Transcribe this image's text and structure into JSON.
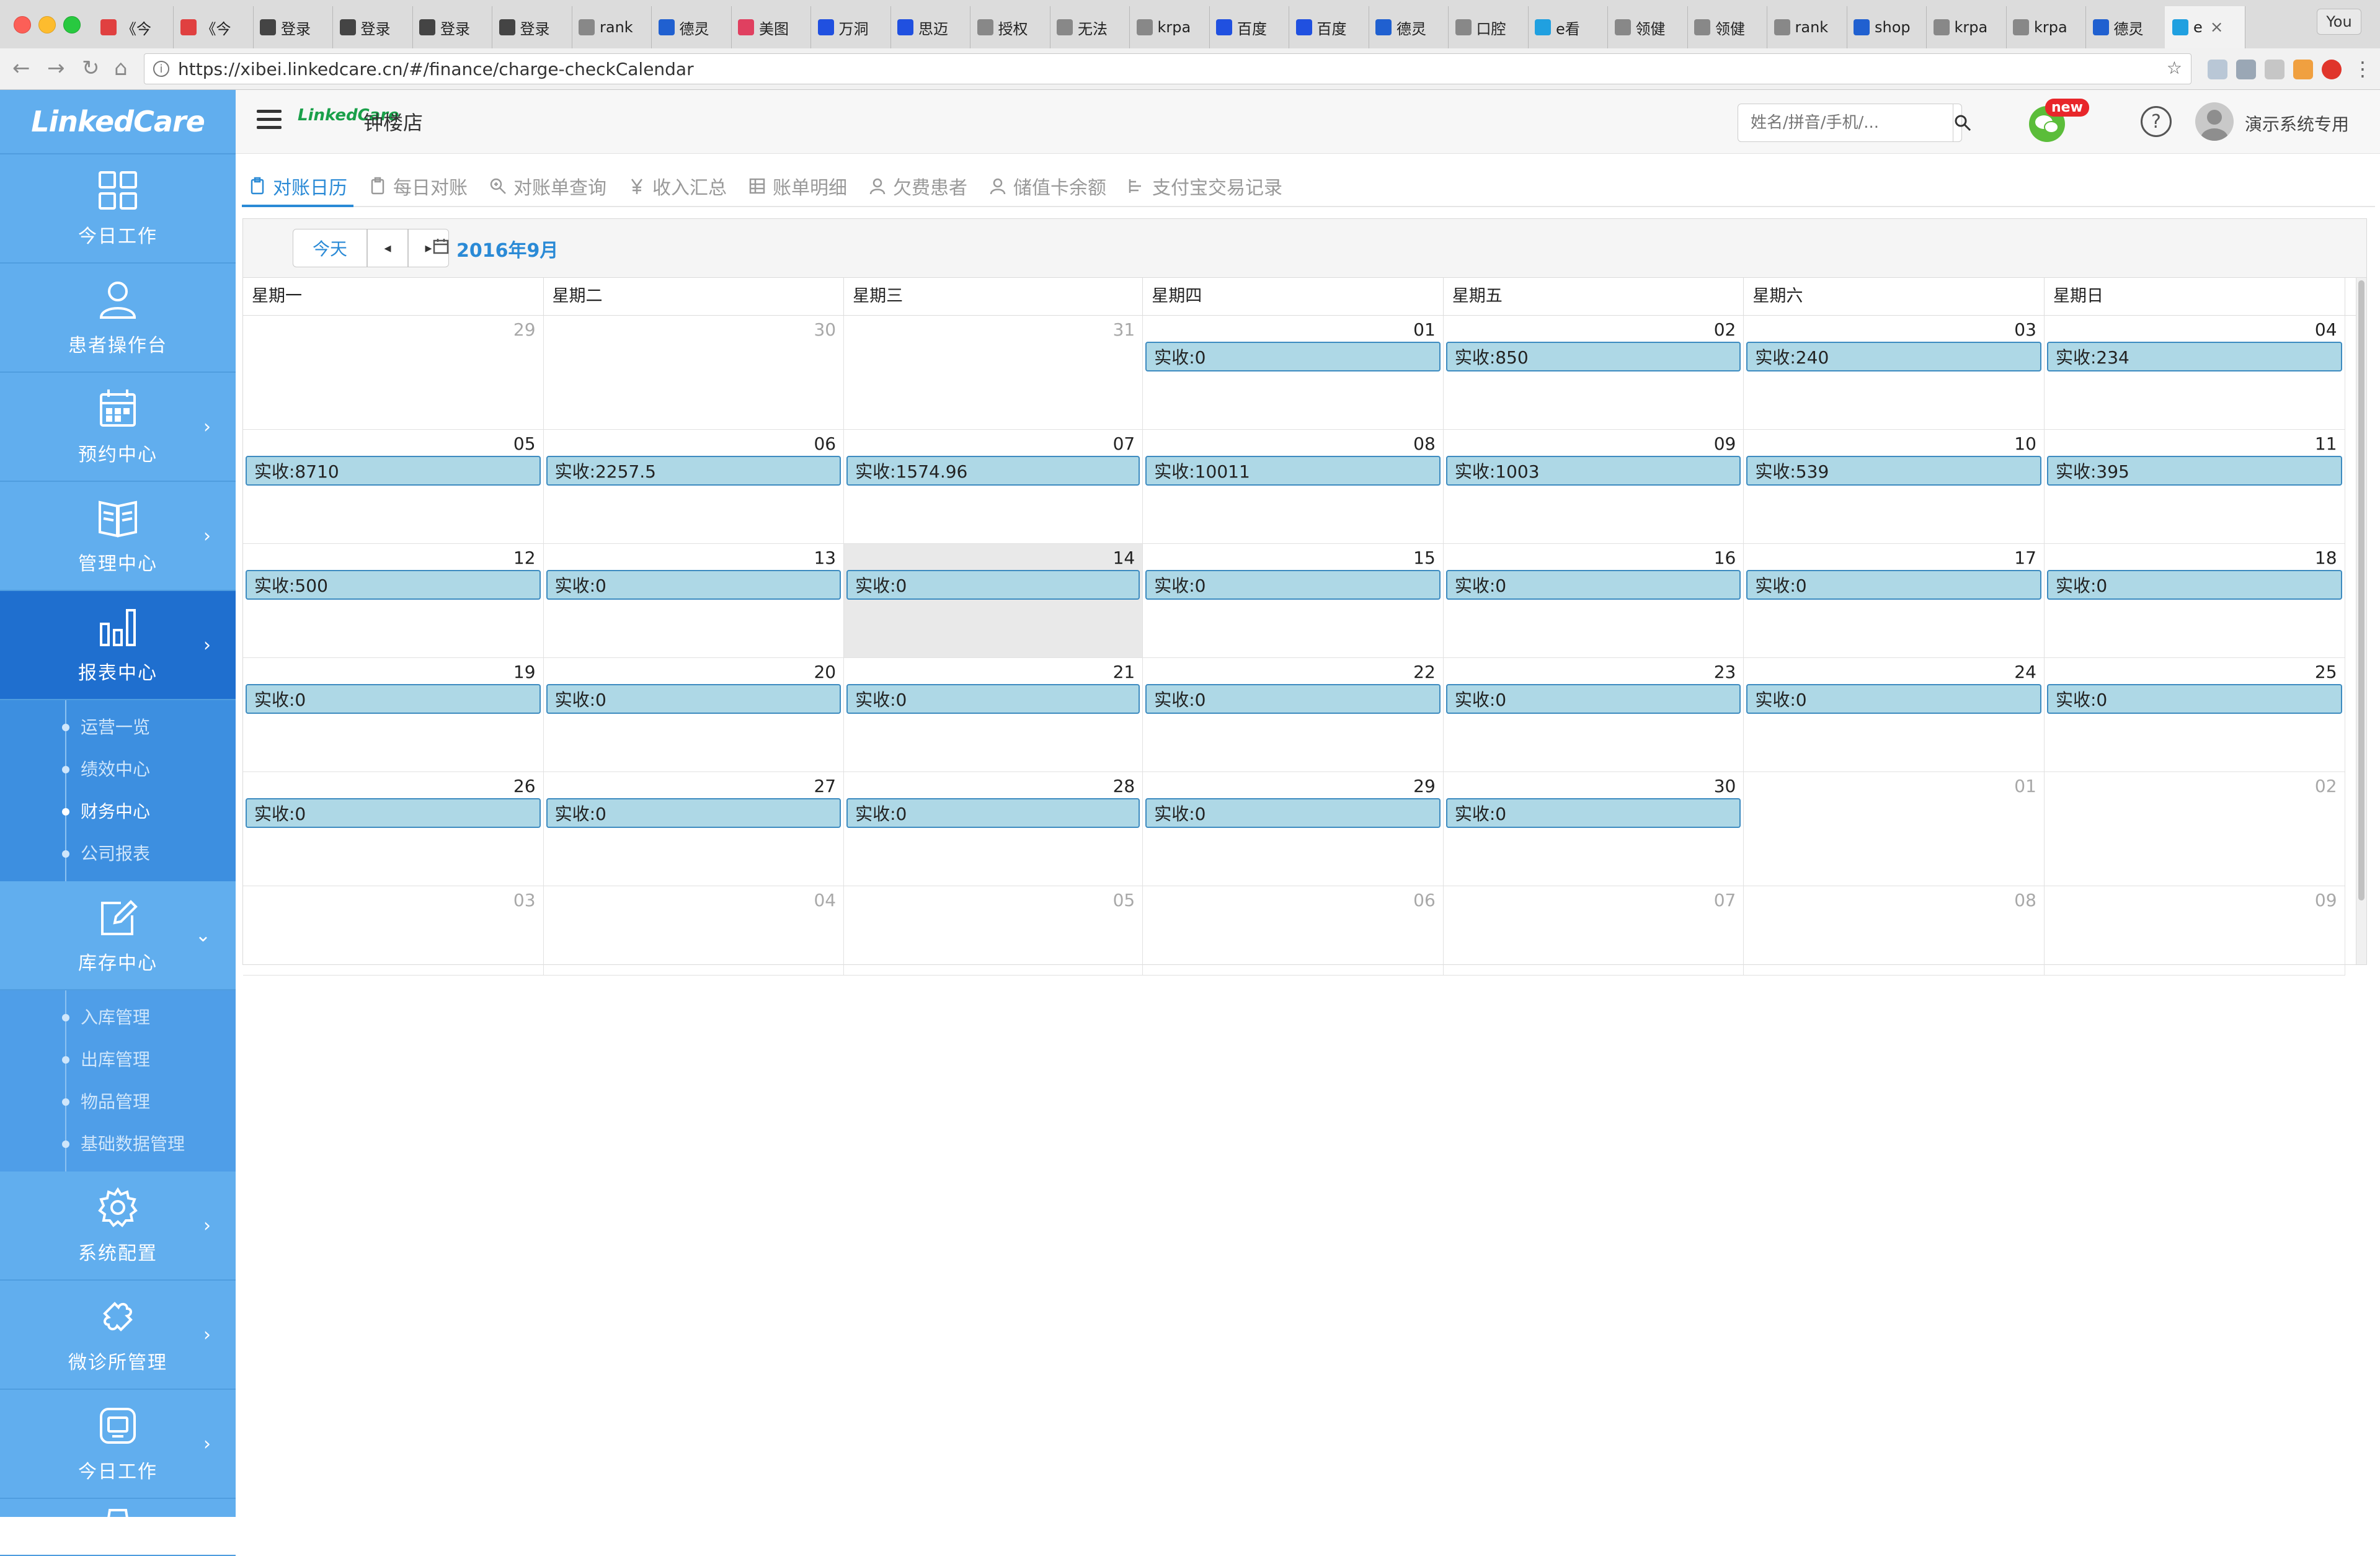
{
  "browser": {
    "tabs": [
      {
        "label": "《今",
        "icon": "tab-red-icon",
        "color": "#e04040"
      },
      {
        "label": "《今",
        "icon": "tab-red-icon",
        "color": "#e04040"
      },
      {
        "label": "登录",
        "icon": "tab-code-icon",
        "color": "#444444"
      },
      {
        "label": "登录",
        "icon": "tab-code-icon",
        "color": "#444444"
      },
      {
        "label": "登录",
        "icon": "tab-code-icon",
        "color": "#444444"
      },
      {
        "label": "登录",
        "icon": "tab-code-icon",
        "color": "#444444"
      },
      {
        "label": "rank",
        "icon": "tab-page-icon",
        "color": "#888888"
      },
      {
        "label": "德灵",
        "icon": "tab-d-icon",
        "color": "#2060d0"
      },
      {
        "label": "美图",
        "icon": "tab-meitu-icon",
        "color": "#e04060"
      },
      {
        "label": "万洞",
        "icon": "tab-baidu-icon",
        "color": "#2050e0"
      },
      {
        "label": "思迈",
        "icon": "tab-baidu-icon",
        "color": "#2050e0"
      },
      {
        "label": "授权",
        "icon": "tab-page-icon",
        "color": "#888888"
      },
      {
        "label": "无法",
        "icon": "tab-page-icon",
        "color": "#888888"
      },
      {
        "label": "krpa",
        "icon": "tab-page-icon",
        "color": "#888888"
      },
      {
        "label": "百度",
        "icon": "tab-baidu-icon",
        "color": "#2050e0"
      },
      {
        "label": "百度",
        "icon": "tab-baidu-icon",
        "color": "#2050e0"
      },
      {
        "label": "德灵",
        "icon": "tab-d-icon",
        "color": "#2060d0"
      },
      {
        "label": "口腔",
        "icon": "tab-page-icon",
        "color": "#888888"
      },
      {
        "label": "e看",
        "icon": "tab-e-icon",
        "color": "#20a0e0"
      },
      {
        "label": "领健",
        "icon": "tab-page-icon",
        "color": "#888888"
      },
      {
        "label": "领健",
        "icon": "tab-page-icon",
        "color": "#888888"
      },
      {
        "label": "rank",
        "icon": "tab-page-icon",
        "color": "#888888"
      },
      {
        "label": "shop",
        "icon": "tab-d-icon",
        "color": "#2060d0"
      },
      {
        "label": "krpa",
        "icon": "tab-page-icon",
        "color": "#888888"
      },
      {
        "label": "krpa",
        "icon": "tab-page-icon",
        "color": "#888888"
      },
      {
        "label": "德灵",
        "icon": "tab-d-icon",
        "color": "#2060d0"
      },
      {
        "label": "e",
        "icon": "tab-e-icon",
        "color": "#20a0e0"
      }
    ],
    "profile_label": "You",
    "url": "https://xibei.linkedcare.cn/#/finance/charge-checkCalendar"
  },
  "sidebar": {
    "logo_text": "LinkedCare",
    "items": [
      {
        "label": "今日工作",
        "icon": "grid-icon",
        "chevron": ""
      },
      {
        "label": "患者操作台",
        "icon": "user-icon",
        "chevron": ""
      },
      {
        "label": "预约中心",
        "icon": "calendar-icon",
        "chevron": "›"
      },
      {
        "label": "管理中心",
        "icon": "book-icon",
        "chevron": "›"
      },
      {
        "label": "报表中心",
        "icon": "bar-chart-icon",
        "chevron": "›"
      },
      {
        "label": "库存中心",
        "icon": "edit-icon",
        "chevron": "⌄"
      },
      {
        "label": "系统配置",
        "icon": "gear-icon",
        "chevron": "›"
      },
      {
        "label": "微诊所管理",
        "icon": "puzzle-icon",
        "chevron": "›"
      },
      {
        "label": "今日工作",
        "icon": "tablet-icon",
        "chevron": "›"
      }
    ],
    "report_sub": [
      "运营一览",
      "绩效中心",
      "财务中心",
      "公司报表"
    ],
    "inventory_sub": [
      "入库管理",
      "出库管理",
      "物品管理",
      "基础数据管理"
    ]
  },
  "header": {
    "mini_logo": "LinkedCare",
    "store_name": "钟楼店",
    "search_placeholder": "姓名/拼音/手机/...",
    "new_badge": "new",
    "help_label": "?",
    "user_name": "演示系统专用"
  },
  "subtabs": [
    "对账日历",
    "每日对账",
    "对账单查询",
    "收入汇总",
    "账单明细",
    "欠费患者",
    "储值卡余额",
    "支付宝交易记录"
  ],
  "calendar": {
    "today_label": "今天",
    "prev_label": "◂",
    "next_label": "▸",
    "month_label": "2016年9月",
    "weekdays": [
      "星期一",
      "星期二",
      "星期三",
      "星期四",
      "星期五",
      "星期六",
      "星期日"
    ],
    "weeks": [
      [
        {
          "d": "29",
          "other": true
        },
        {
          "d": "30",
          "other": true
        },
        {
          "d": "31",
          "other": true
        },
        {
          "d": "01",
          "ev": "实收:0"
        },
        {
          "d": "02",
          "ev": "实收:850"
        },
        {
          "d": "03",
          "ev": "实收:240"
        },
        {
          "d": "04",
          "ev": "实收:234"
        }
      ],
      [
        {
          "d": "05",
          "ev": "实收:8710"
        },
        {
          "d": "06",
          "ev": "实收:2257.5"
        },
        {
          "d": "07",
          "ev": "实收:1574.96"
        },
        {
          "d": "08",
          "ev": "实收:10011"
        },
        {
          "d": "09",
          "ev": "实收:1003"
        },
        {
          "d": "10",
          "ev": "实收:539"
        },
        {
          "d": "11",
          "ev": "实收:395"
        }
      ],
      [
        {
          "d": "12",
          "ev": "实收:500"
        },
        {
          "d": "13",
          "ev": "实收:0"
        },
        {
          "d": "14",
          "ev": "实收:0",
          "today": true
        },
        {
          "d": "15",
          "ev": "实收:0"
        },
        {
          "d": "16",
          "ev": "实收:0"
        },
        {
          "d": "17",
          "ev": "实收:0"
        },
        {
          "d": "18",
          "ev": "实收:0"
        }
      ],
      [
        {
          "d": "19",
          "ev": "实收:0"
        },
        {
          "d": "20",
          "ev": "实收:0"
        },
        {
          "d": "21",
          "ev": "实收:0"
        },
        {
          "d": "22",
          "ev": "实收:0"
        },
        {
          "d": "23",
          "ev": "实收:0"
        },
        {
          "d": "24",
          "ev": "实收:0"
        },
        {
          "d": "25",
          "ev": "实收:0"
        }
      ],
      [
        {
          "d": "26",
          "ev": "实收:0"
        },
        {
          "d": "27",
          "ev": "实收:0"
        },
        {
          "d": "28",
          "ev": "实收:0"
        },
        {
          "d": "29",
          "ev": "实收:0"
        },
        {
          "d": "30",
          "ev": "实收:0"
        },
        {
          "d": "01",
          "other": true
        },
        {
          "d": "02",
          "other": true
        }
      ],
      [
        {
          "d": "03",
          "other": true
        },
        {
          "d": "04",
          "other": true
        },
        {
          "d": "05",
          "other": true
        },
        {
          "d": "06",
          "other": true
        },
        {
          "d": "07",
          "other": true
        },
        {
          "d": "08",
          "other": true
        },
        {
          "d": "09",
          "other": true
        }
      ]
    ]
  },
  "colors": {
    "sidebar": "#61aeee",
    "sidebar_active": "#1f6fcf",
    "accent": "#2a8ad6",
    "event_bg": "#aed8e6",
    "event_border": "#3d8bc0",
    "new_badge": "#e8262a"
  }
}
